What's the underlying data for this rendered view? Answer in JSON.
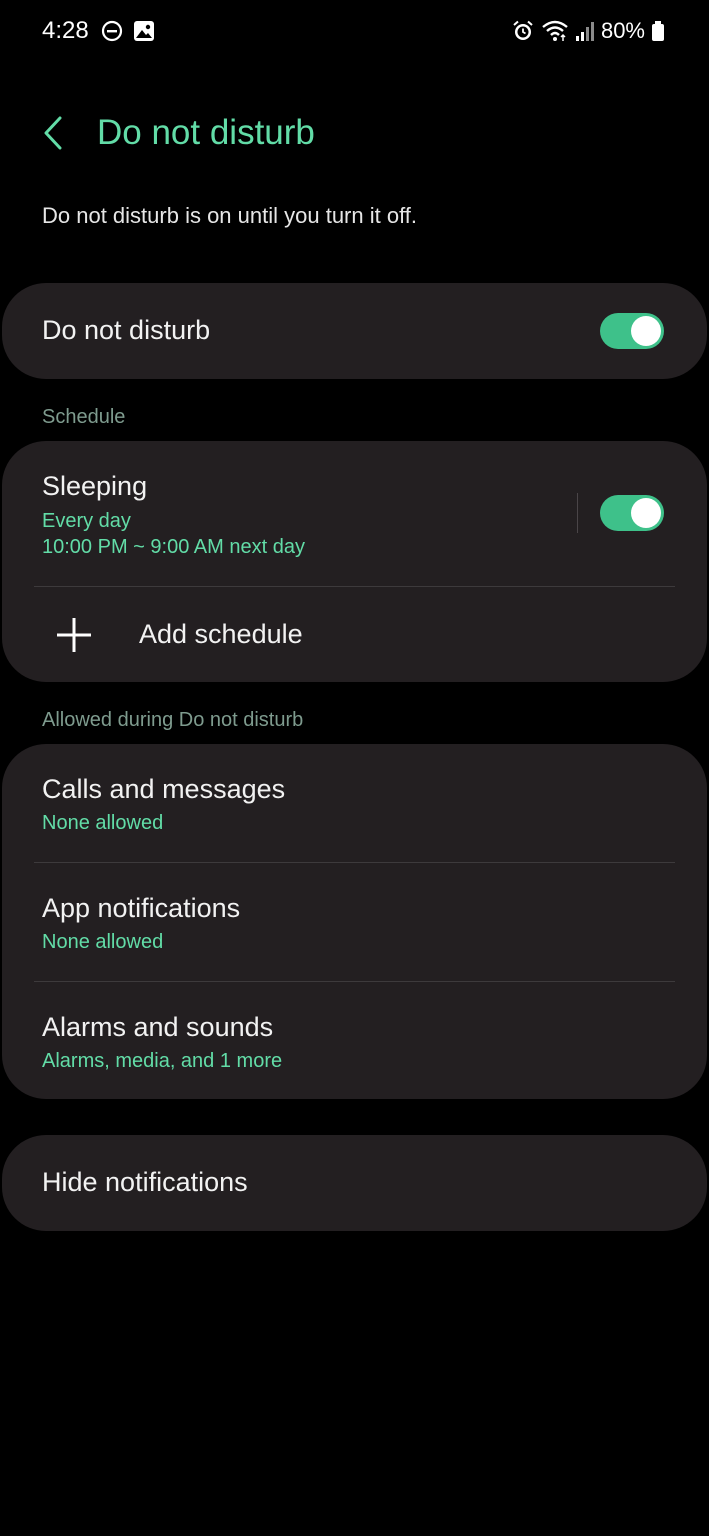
{
  "status_bar": {
    "time": "4:28",
    "battery_pct": "80%",
    "left_icons": [
      "dnd-icon",
      "gallery-icon"
    ],
    "right_icons": [
      "alarm-icon",
      "wifi-icon",
      "signal-icon",
      "battery-icon"
    ]
  },
  "header": {
    "title": "Do not disturb",
    "back_icon": "chevron-left-icon"
  },
  "description": "Do not disturb is on until you turn it off.",
  "dnd_row": {
    "label": "Do not disturb",
    "enabled": true
  },
  "schedule": {
    "section_label": "Schedule",
    "items": [
      {
        "title": "Sleeping",
        "days": "Every day",
        "time": "10:00 PM ~ 9:00 AM next day",
        "enabled": true
      }
    ],
    "add_label": "Add schedule"
  },
  "allowed": {
    "section_label": "Allowed during Do not disturb",
    "items": [
      {
        "title": "Calls and messages",
        "subtitle": "None allowed"
      },
      {
        "title": "App notifications",
        "subtitle": "None allowed"
      },
      {
        "title": "Alarms and sounds",
        "subtitle": "Alarms, media, and 1 more"
      }
    ]
  },
  "hide_notifications": {
    "label": "Hide notifications"
  },
  "colors": {
    "accent": "#62dca7",
    "toggle_on": "#3ec18a",
    "card_bg": "#231f21",
    "background": "#000000"
  }
}
